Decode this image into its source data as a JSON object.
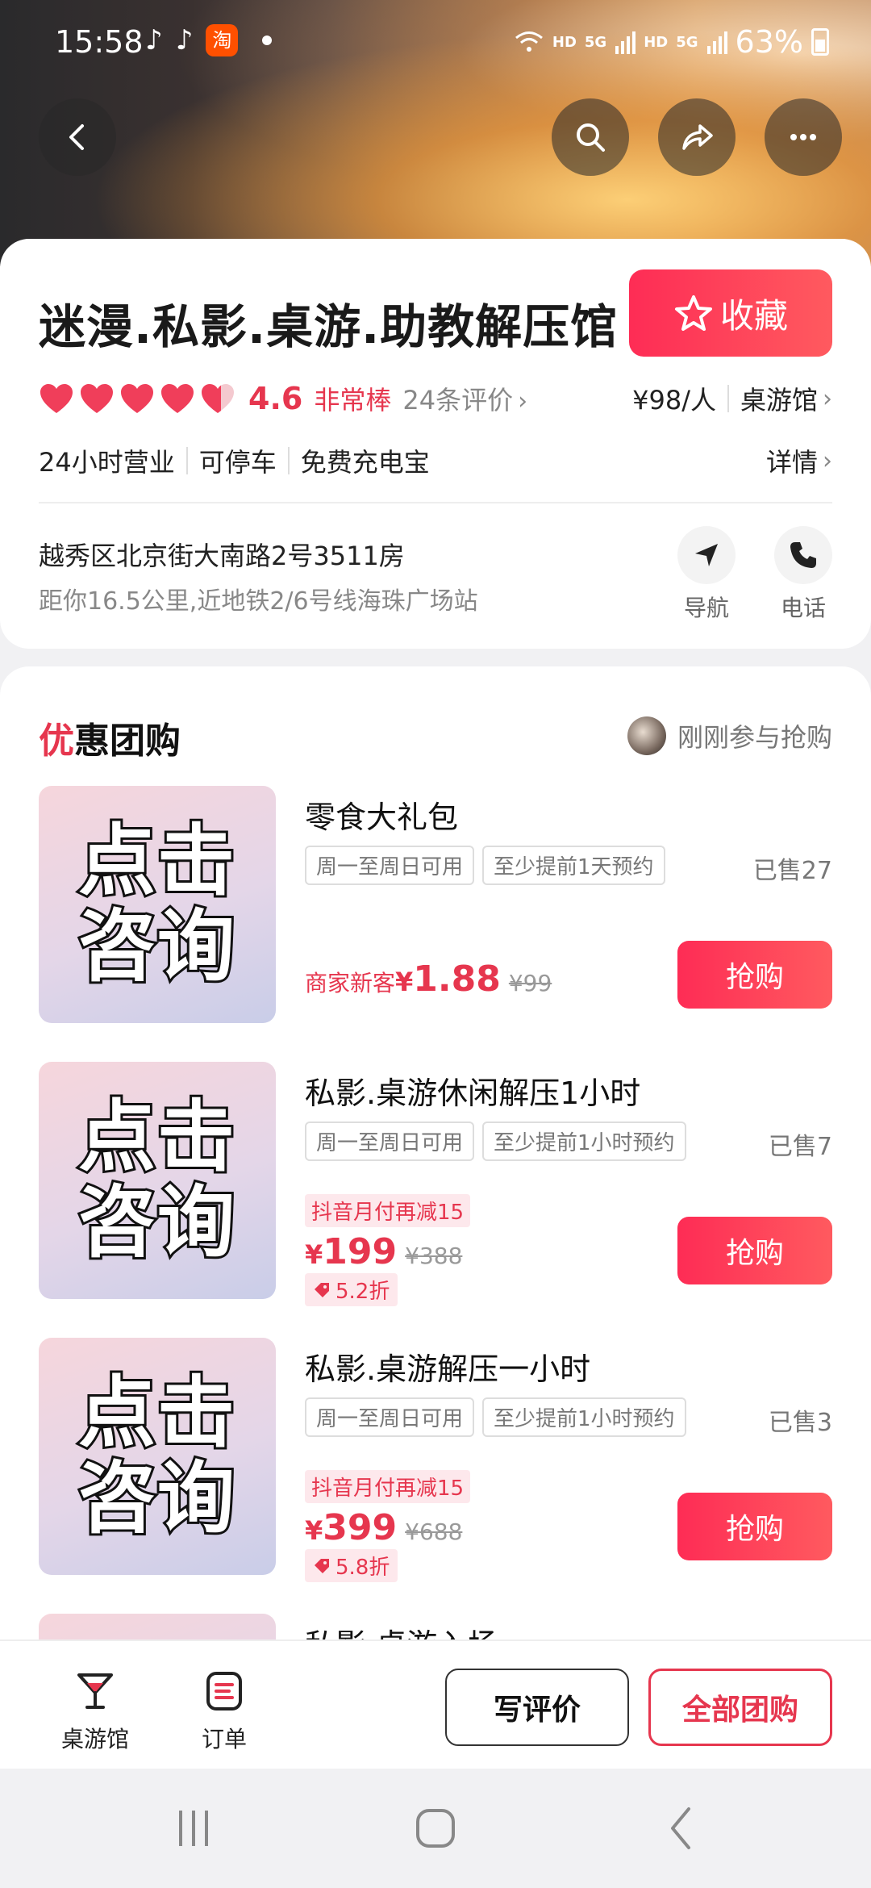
{
  "status_bar": {
    "time": "15:58",
    "net1": "HD",
    "net2": "5G",
    "net3": "HD",
    "net4": "5G",
    "battery": "63%"
  },
  "store": {
    "name": "迷漫.私影.桌游.助教解压馆",
    "favorite_label": "收藏",
    "score": "4.6",
    "praise": "非常棒",
    "reviews": "24条评价",
    "price_per_person": "¥98/人",
    "category": "桌游馆",
    "tags": [
      "24小时营业",
      "可停车",
      "免费充电宝"
    ],
    "details_label": "详情",
    "address": "越秀区北京街大南路2号3511房",
    "distance": "距你16.5公里,近地铁2/6号线海珠广场站",
    "navigate_label": "导航",
    "phone_label": "电话"
  },
  "deals_section": {
    "title_first": "优",
    "title_rest": "惠团购",
    "just_joined": "刚刚参与抢购",
    "items": [
      {
        "thumb_line1": "点击",
        "thumb_line2": "咨询",
        "name": "零食大礼包",
        "chip1": "周一至周日可用",
        "chip2": "至少提前1天预约",
        "sold": "已售27",
        "newcust": "商家新客",
        "yen": "¥",
        "price": "1.88",
        "orig": "¥99",
        "buy": "抢购"
      },
      {
        "thumb_line1": "点击",
        "thumb_line2": "咨询",
        "name": "私影.桌游休闲解压1小时",
        "chip1": "周一至周日可用",
        "chip2": "至少提前1小时预约",
        "sold": "已售7",
        "promo": "抖音月付再减15",
        "yen": "¥",
        "price": "199",
        "orig": "¥388",
        "discount": "5.2折",
        "buy": "抢购"
      },
      {
        "thumb_line1": "点击",
        "thumb_line2": "咨询",
        "name": "私影.桌游解压一小时",
        "chip1": "周一至周日可用",
        "chip2": "至少提前1小时预约",
        "sold": "已售3",
        "promo": "抖音月付再减15",
        "yen": "¥",
        "price": "399",
        "orig": "¥688",
        "discount": "5.8折",
        "buy": "抢购"
      },
      {
        "name": "私影.桌游入场"
      }
    ]
  },
  "bottom_bar": {
    "tab_store": "桌游馆",
    "tab_orders": "订单",
    "write_review": "写评价",
    "all_deals": "全部团购"
  },
  "colors": {
    "accent": "#e6364e",
    "button_gradient_start": "#fe2c55",
    "button_gradient_end": "#ff5a5f"
  }
}
